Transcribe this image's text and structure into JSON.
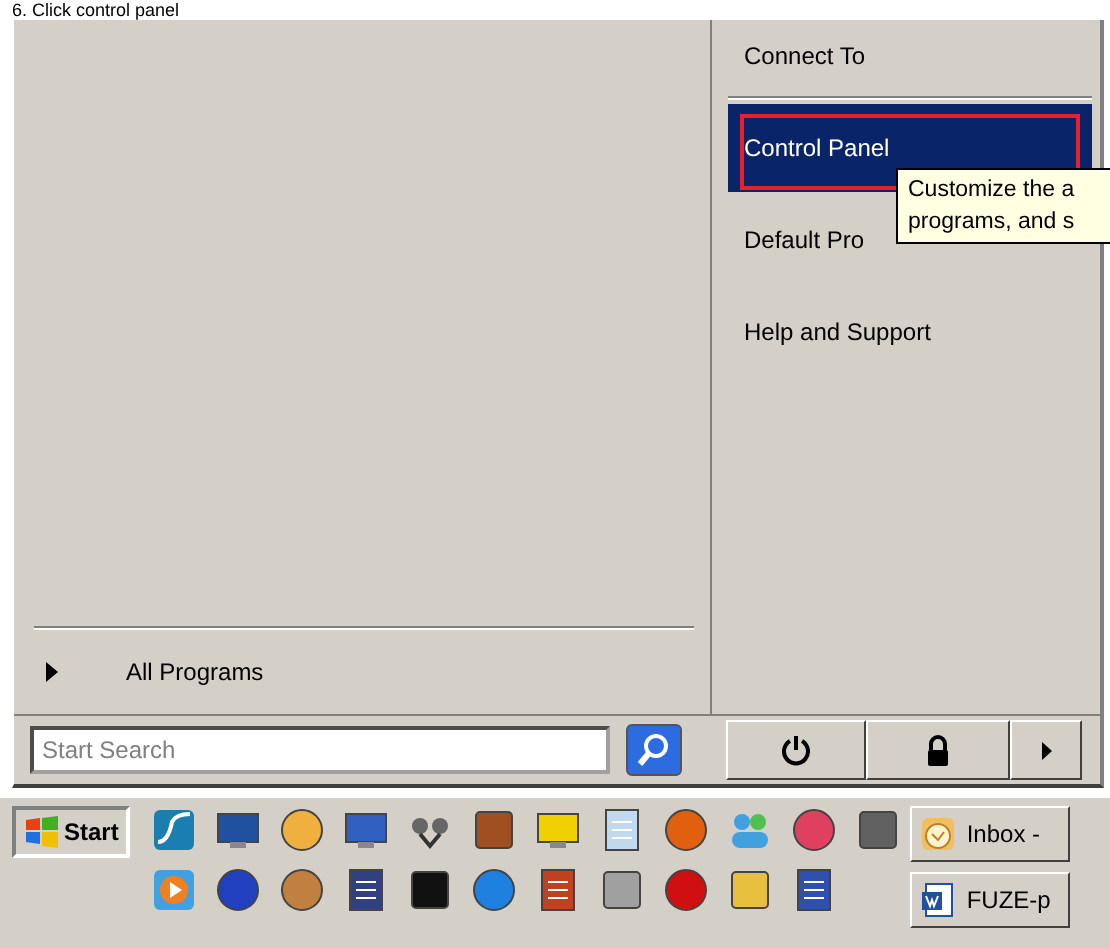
{
  "caption": "6. Click control panel",
  "right_items": [
    {
      "label": "Connect To",
      "selected": false
    },
    {
      "label": "Control Panel",
      "selected": true
    },
    {
      "label": "Default Pro",
      "selected": false
    },
    {
      "label": "Help and Support",
      "selected": false
    }
  ],
  "tooltip": {
    "lines": [
      "Customize the a",
      "programs, and s"
    ]
  },
  "all_programs": {
    "label": "All Programs"
  },
  "search": {
    "placeholder": "Start Search"
  },
  "taskbar": {
    "start": "Start",
    "tasks": [
      {
        "label": "Inbox -",
        "kind": "mail"
      },
      {
        "label": "FUZE-p",
        "kind": "document"
      }
    ]
  }
}
